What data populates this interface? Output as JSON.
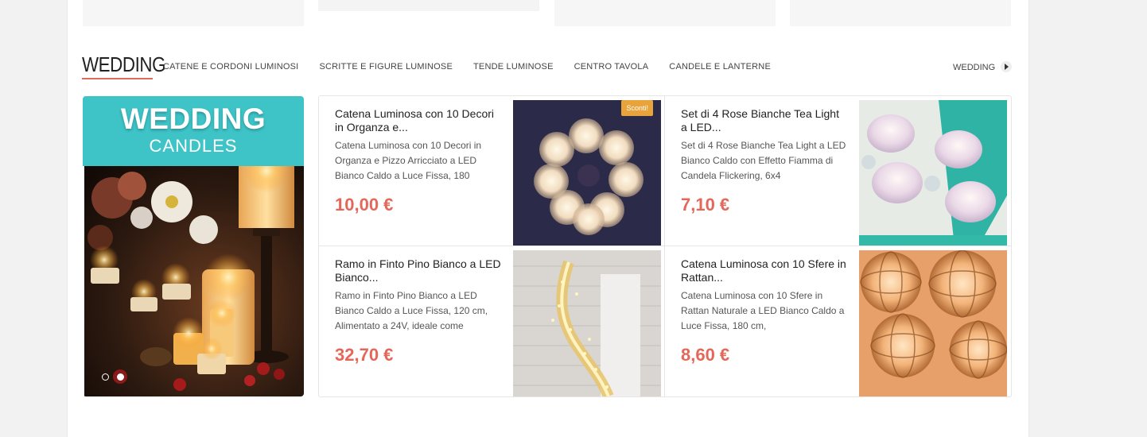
{
  "section": {
    "title": "WEDDING",
    "categories": [
      "CATENE E CORDONI LUMINOSI",
      "SCRITTE E FIGURE LUMINOSE",
      "TENDE LUMINOSE",
      "CENTRO TAVOLA",
      "CANDELE E LANTERNE"
    ],
    "all_link": "WEDDING"
  },
  "banner": {
    "title": "WEDDING",
    "subtitle": "CANDLES",
    "slide_count": 2,
    "active_slide": 2
  },
  "products": [
    {
      "title": "Catena Luminosa con 10 Decori in Organza e...",
      "description": "Catena Luminosa con 10 Decori in Organza e Pizzo Arricciato a LED Bianco Caldo a Luce Fissa, 180",
      "price": "10,00 €",
      "badge": "Sconti!"
    },
    {
      "title": "Set di 4 Rose Bianche Tea Light a LED...",
      "description": "Set di 4 Rose Bianche Tea Light a LED Bianco Caldo con Effetto Fiamma di Candela Flickering, 6x4",
      "price": "7,10 €"
    },
    {
      "title": "Ramo in Finto Pino Bianco a LED Bianco...",
      "description": "Ramo in Finto Pino Bianco a LED Bianco Caldo a Luce Fissa, 120 cm, Alimentato a 24V, ideale come",
      "price": "32,70 €"
    },
    {
      "title": "Catena Luminosa con 10 Sfere in Rattan...",
      "description": "Catena Luminosa con 10 Sfere in Rattan Naturale a LED Bianco Caldo a Luce Fissa, 180 cm,",
      "price": "8,60 €"
    }
  ],
  "colors": {
    "accent": "#e26a5a",
    "price": "#e4675a",
    "banner": "#3ec3c7",
    "badge": "#e8a33a"
  }
}
